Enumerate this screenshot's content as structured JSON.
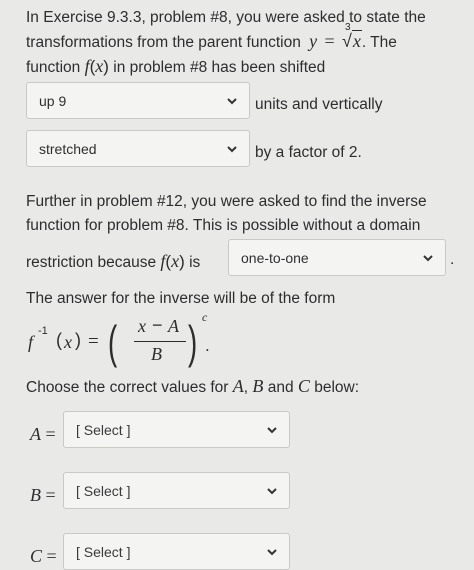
{
  "intro": {
    "line1": "In Exercise 9.3.3, problem #8, you were asked to state the",
    "line2_pre": "transformations from the parent function",
    "eq_y": "y",
    "eq_equals": "=",
    "root_index": "3",
    "root_var": "x",
    "line2_post": ". The",
    "line3_pre": "function",
    "fx_f": "f",
    "fx_x": "x",
    "line3_post": "in problem #8 has been shifted"
  },
  "selects": {
    "shift": {
      "value": "up 9"
    },
    "stretch": {
      "value": "stretched"
    },
    "restriction": {
      "value": "one-to-one"
    },
    "A": {
      "placeholder": "[ Select ]"
    },
    "B": {
      "placeholder": "[ Select ]"
    },
    "C": {
      "placeholder": "[ Select ]"
    }
  },
  "after_shift": "units and vertically",
  "after_stretch": "by a factor of 2.",
  "further": {
    "line1": "Further in problem #12, you were asked to find the inverse",
    "line2": "function for problem #8. This is possible without a domain",
    "line3_pre": "restriction because",
    "line3_is": "is",
    "period": "."
  },
  "answer_line": "The answer for the inverse will be of the form",
  "formula": {
    "f": "f",
    "exp": "-1",
    "x": "x",
    "equals": "=",
    "numer_x": "x",
    "minus": "−",
    "numer_A": "A",
    "denom": "B",
    "power": "c",
    "period": "."
  },
  "choose": {
    "pre": "Choose the correct values for",
    "A": "A",
    "comma": ",",
    "B": "B",
    "and": "and",
    "C": "C",
    "post": "below:"
  },
  "labels": {
    "A": "A",
    "B": "B",
    "C": "C",
    "equals": "="
  }
}
